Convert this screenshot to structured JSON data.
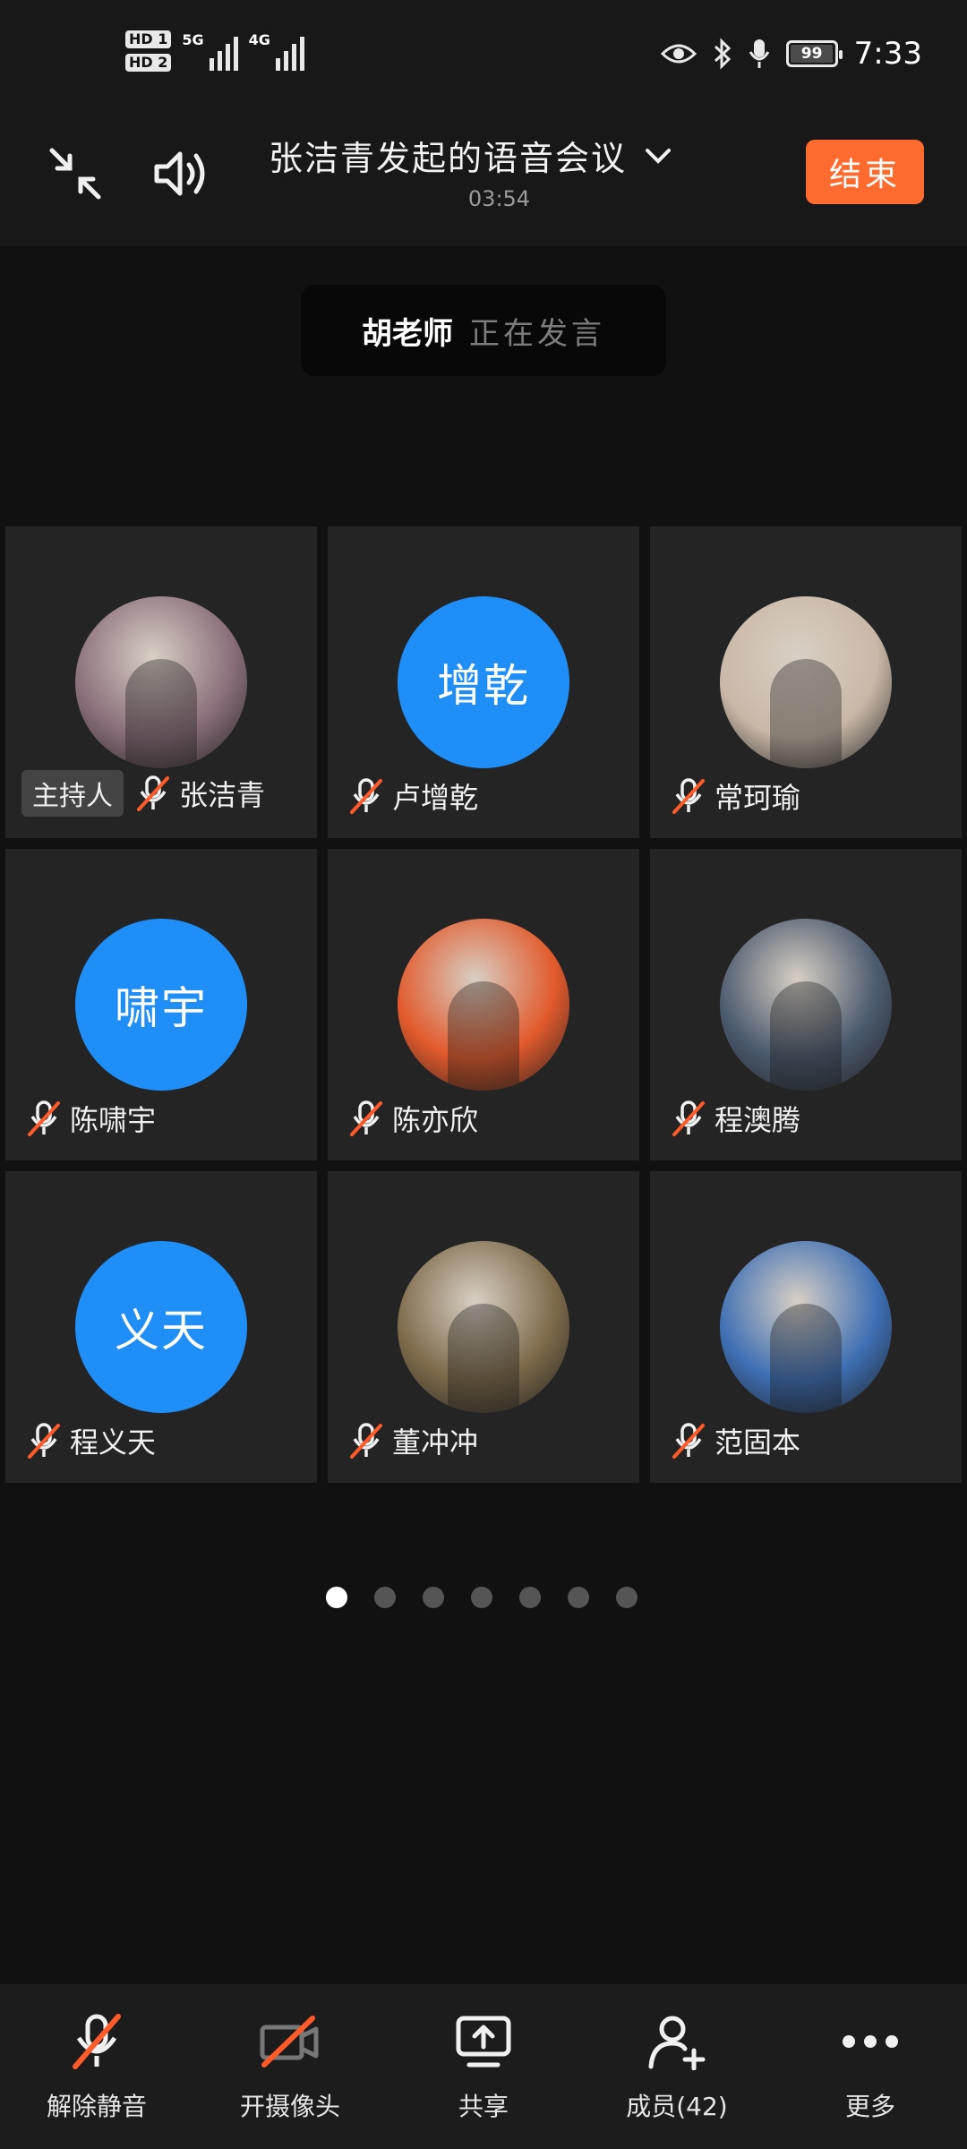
{
  "status": {
    "sim1": "HD 1",
    "sim2": "HD 2",
    "net1": "5G",
    "net2": "4G",
    "battery": "99",
    "battery_level": 0.99,
    "time": "7:33"
  },
  "header": {
    "title": "张洁青发起的语音会议",
    "timer": "03:54",
    "end_label": "结束"
  },
  "speaker": {
    "name": "胡老师",
    "suffix": "正在发言"
  },
  "host_tag": "主持人",
  "participants": [
    {
      "name": "张洁青",
      "avatar": "photo",
      "avatar_color": "#8a6f7a"
    },
    {
      "name": "卢增乾",
      "avatar": "text",
      "avatar_text": "增乾"
    },
    {
      "name": "常珂瑜",
      "avatar": "photo",
      "avatar_color": "#c9b8a8"
    },
    {
      "name": "陈啸宇",
      "avatar": "text",
      "avatar_text": "啸宇"
    },
    {
      "name": "陈亦欣",
      "avatar": "photo",
      "avatar_color": "#e25a2c"
    },
    {
      "name": "程澳腾",
      "avatar": "photo",
      "avatar_color": "#4b5a6e"
    },
    {
      "name": "程义天",
      "avatar": "text",
      "avatar_text": "义天"
    },
    {
      "name": "董冲冲",
      "avatar": "photo",
      "avatar_color": "#7d6a4a"
    },
    {
      "name": "范固本",
      "avatar": "photo",
      "avatar_color": "#3e6fb4"
    }
  ],
  "pager": {
    "pages": 7,
    "current": 1
  },
  "toolbar": {
    "unmute": "解除静音",
    "camera": "开摄像头",
    "share": "共享",
    "members": "成员(42)",
    "more": "更多"
  },
  "colors": {
    "accent_end": "#ff6a2e",
    "avatar_blue": "#1f8ef7",
    "mute_slash": "#ff5a2a"
  }
}
